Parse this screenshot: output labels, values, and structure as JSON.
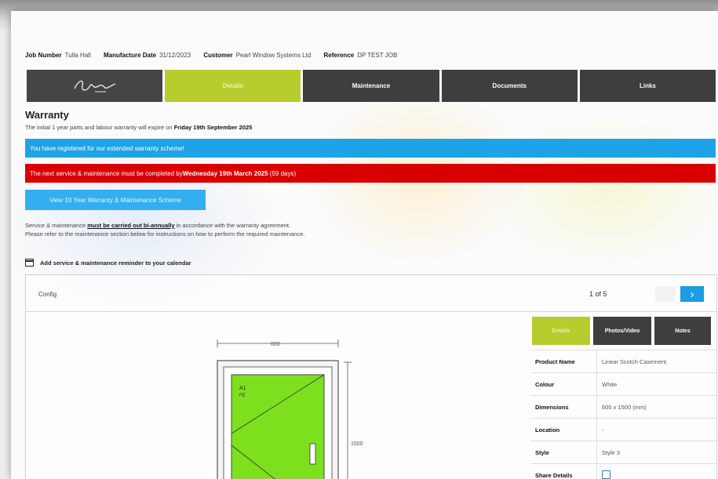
{
  "header": {
    "fields": [
      {
        "label": "Job Number",
        "value": "Tulla Hall"
      },
      {
        "label": "Manufacture Date",
        "value": "31/12/2023"
      },
      {
        "label": "Customer",
        "value": "Pearl Window Systems Ltd"
      },
      {
        "label": "Reference",
        "value": "DP TEST JOB"
      }
    ]
  },
  "nav": {
    "tabs": [
      {
        "label": ""
      },
      {
        "label": "Details"
      },
      {
        "label": "Maintenance"
      },
      {
        "label": "Documents"
      },
      {
        "label": "Links"
      }
    ],
    "active_color": "#b8cc2e"
  },
  "warranty": {
    "title": "Warranty",
    "intro_prefix": "The initial 1 year parts and labour warranty will expire on ",
    "expiry_date": "Friday 19th September 2025",
    "registered_notice": "You have registered for our extended warranty scheme!",
    "service_notice_prefix": "The next service & maintenance must be completed by ",
    "service_date": "Wednesday 19th March 2025",
    "service_days": "(59 days)",
    "button_label": "View 10 Year Warranty & Maintenance Scheme",
    "service_text_1a": "Service & maintenance ",
    "service_text_1b": "must be carried out bi-annually",
    "service_text_1c": " in accordance with the warranty agreement.",
    "service_text_2": "Please refer to the maintenance section below for instructions on how to perform the required maintenance.",
    "calendar_link": "Add service & maintenance reminder to your calendar"
  },
  "product_panel": {
    "label": "Config",
    "count": "1 of 5",
    "side_tabs": [
      "Details",
      "Photos/Video",
      "Notes"
    ],
    "specs": [
      {
        "key": "Product Name",
        "value": "Linear Scotch Casement"
      },
      {
        "key": "Colour",
        "value": "White"
      },
      {
        "key": "Dimensions",
        "value": "600 x 1500 (mm)"
      },
      {
        "key": "Location",
        "value": "-"
      },
      {
        "key": "Style",
        "value": "Style 3"
      },
      {
        "key": "Share Details",
        "value": ""
      }
    ],
    "drawing": {
      "width_label": "600",
      "height_label": "1500",
      "sash_label": "A1",
      "sash_sub": "FE",
      "glass_color": "#7de01f"
    }
  },
  "colors": {
    "blue_bar": "#1ea3e6",
    "red_bar": "#d90000",
    "dark_tab": "#3e3e3e",
    "next_button": "#1d9be5"
  },
  "icons": [
    "calendar-icon",
    "chevron-right-icon",
    "share-checkbox-icon",
    "signature-logo-icon"
  ]
}
